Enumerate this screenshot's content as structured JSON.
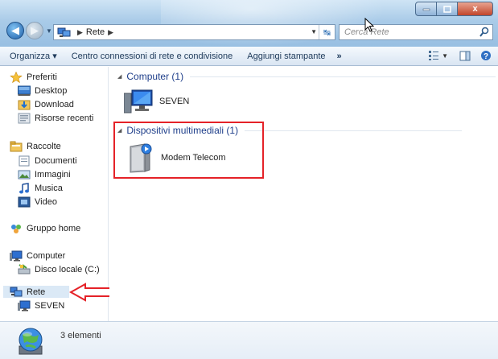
{
  "window": {
    "controls": {
      "minimize_icon": "minimize-icon",
      "maximize_icon": "maximize-icon",
      "close_label": "x"
    }
  },
  "address": {
    "breadcrumb": [
      "Rete"
    ],
    "search_placeholder": "Cerca Rete"
  },
  "toolbar": {
    "organize_label": "Organizza",
    "network_center_label": "Centro connessioni di rete e condivisione",
    "add_printer_label": "Aggiungi stampante",
    "more_label": "»"
  },
  "sidebar": {
    "favorites": {
      "label": "Preferiti",
      "items": [
        {
          "label": "Desktop"
        },
        {
          "label": "Download"
        },
        {
          "label": "Risorse recenti"
        }
      ]
    },
    "libraries": {
      "label": "Raccolte",
      "items": [
        {
          "label": "Documenti"
        },
        {
          "label": "Immagini"
        },
        {
          "label": "Musica"
        },
        {
          "label": "Video"
        }
      ]
    },
    "homegroup": {
      "label": "Gruppo home"
    },
    "computer": {
      "label": "Computer",
      "items": [
        {
          "label": "Disco locale (C:)"
        }
      ]
    },
    "network": {
      "label": "Rete",
      "items": [
        {
          "label": "SEVEN"
        }
      ]
    }
  },
  "content": {
    "groups": [
      {
        "header": "Computer (1)",
        "items": [
          {
            "label": "SEVEN",
            "icon": "computer-icon"
          }
        ]
      },
      {
        "header": "Dispositivi multimediali (1)",
        "items": [
          {
            "label": "Modem Telecom",
            "icon": "media-device-icon"
          }
        ]
      }
    ]
  },
  "status": {
    "count_label": "3 elementi"
  },
  "colors": {
    "highlight": "#e52228",
    "accent": "#1e3e8a",
    "selection": "#dbe9f6"
  }
}
